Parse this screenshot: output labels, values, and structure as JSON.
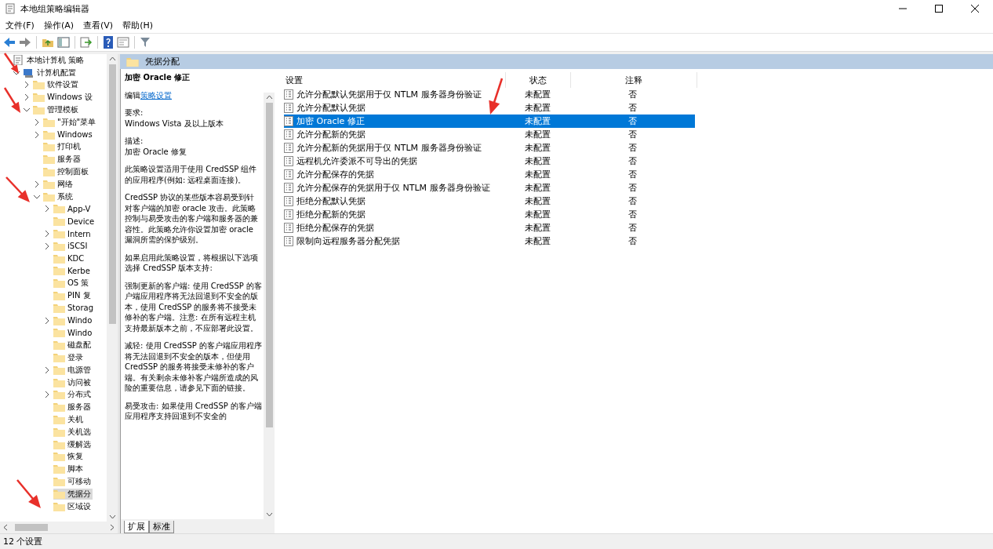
{
  "window": {
    "title": "本地组策略编辑器"
  },
  "menu": [
    "文件(F)",
    "操作(A)",
    "查看(V)",
    "帮助(H)"
  ],
  "tree": [
    {
      "label": "本地计算机 策略",
      "kind": "policy",
      "selected": false,
      "children": [
        {
          "label": "计算机配置",
          "kind": "computer",
          "expanded": true,
          "selected": false,
          "children": [
            {
              "label": "软件设置",
              "kind": "folder",
              "expanded": false,
              "selected": false
            },
            {
              "label": "Windows 设",
              "kind": "folder",
              "expanded": false,
              "selected": false
            },
            {
              "label": "管理模板",
              "kind": "folder",
              "expanded": true,
              "selected": false,
              "children": [
                {
                  "label": "\"开始\"菜单",
                  "kind": "folder",
                  "expanded": false,
                  "selected": false
                },
                {
                  "label": "Windows",
                  "kind": "folder",
                  "expanded": false,
                  "selected": false
                },
                {
                  "label": "打印机",
                  "kind": "folder",
                  "selected": false
                },
                {
                  "label": "服务器",
                  "kind": "folder",
                  "selected": false
                },
                {
                  "label": "控制面板",
                  "kind": "folder",
                  "selected": false
                },
                {
                  "label": "网络",
                  "kind": "folder",
                  "expanded": false,
                  "selected": false
                },
                {
                  "label": "系统",
                  "kind": "folder",
                  "expanded": true,
                  "selected": false,
                  "children": [
                    {
                      "label": "App-V",
                      "kind": "folder",
                      "expanded": false,
                      "selected": false
                    },
                    {
                      "label": "Device",
                      "kind": "folder",
                      "selected": false
                    },
                    {
                      "label": "Intern",
                      "kind": "folder",
                      "expanded": false,
                      "selected": false
                    },
                    {
                      "label": "iSCSI",
                      "kind": "folder",
                      "expanded": false,
                      "selected": false
                    },
                    {
                      "label": "KDC",
                      "kind": "folder",
                      "selected": false
                    },
                    {
                      "label": "Kerbe",
                      "kind": "folder",
                      "selected": false
                    },
                    {
                      "label": "OS 策",
                      "kind": "folder",
                      "selected": false
                    },
                    {
                      "label": "PIN 复",
                      "kind": "folder",
                      "selected": false
                    },
                    {
                      "label": "Storag",
                      "kind": "folder",
                      "selected": false
                    },
                    {
                      "label": "Windo",
                      "kind": "folder",
                      "expanded": false,
                      "selected": false
                    },
                    {
                      "label": "Windo",
                      "kind": "folder",
                      "selected": false
                    },
                    {
                      "label": "磁盘配",
                      "kind": "folder",
                      "selected": false
                    },
                    {
                      "label": "登录",
                      "kind": "folder",
                      "selected": false
                    },
                    {
                      "label": "电源管",
                      "kind": "folder",
                      "expanded": false,
                      "selected": false
                    },
                    {
                      "label": "访问被",
                      "kind": "folder",
                      "selected": false
                    },
                    {
                      "label": "分布式",
                      "kind": "folder",
                      "expanded": false,
                      "selected": false
                    },
                    {
                      "label": "服务器",
                      "kind": "folder",
                      "selected": false
                    },
                    {
                      "label": "关机",
                      "kind": "folder",
                      "selected": false
                    },
                    {
                      "label": "关机选",
                      "kind": "folder",
                      "selected": false
                    },
                    {
                      "label": "缓解选",
                      "kind": "folder",
                      "selected": false
                    },
                    {
                      "label": "恢复",
                      "kind": "folder",
                      "selected": false
                    },
                    {
                      "label": "脚本",
                      "kind": "folder",
                      "selected": false
                    },
                    {
                      "label": "可移动",
                      "kind": "folder",
                      "selected": false
                    },
                    {
                      "label": "凭据分",
                      "kind": "folder",
                      "selected": true
                    },
                    {
                      "label": "区域设",
                      "kind": "folder",
                      "selected": false
                    }
                  ]
                }
              ]
            }
          ]
        }
      ]
    }
  ],
  "header": {
    "title": "凭据分配"
  },
  "description": {
    "title": "加密 Oracle 修正",
    "edit_prefix": "编辑",
    "edit_link": "策略设置",
    "requirements_label": "要求:",
    "requirements": "Windows Vista 及以上版本",
    "description_label": "描述:",
    "description": "加密 Oracle 修复",
    "paragraphs": [
      "此策略设置适用于使用 CredSSP 组件的应用程序(例如: 远程桌面连接)。",
      "CredSSP 协议的某些版本容易受到针对客户端的加密 oracle 攻击。此策略控制与易受攻击的客户端和服务器的兼容性。此策略允许你设置加密 oracle 漏洞所需的保护级别。",
      "如果启用此策略设置，将根据以下选项选择 CredSSP 版本支持:",
      "强制更新的客户端: 使用 CredSSP 的客户端应用程序将无法回退到不安全的版本，使用 CredSSP 的服务将不接受未修补的客户端。注意: 在所有远程主机支持最新版本之前，不应部署此设置。",
      "减轻: 使用 CredSSP 的客户端应用程序将无法回退到不安全的版本，但使用 CredSSP 的服务将接受未修补的客户端。有关剩余未修补客户端所造成的风险的重要信息，请参见下面的链接。",
      "易受攻击: 如果使用 CredSSP 的客户端应用程序支持回退到不安全的"
    ],
    "tabs": [
      {
        "label": "扩展",
        "selected": true
      },
      {
        "label": "标准",
        "selected": false
      }
    ]
  },
  "table": {
    "columns": [
      "设置",
      "状态",
      "注释"
    ],
    "rows": [
      {
        "setting": "允许分配默认凭据用于仅 NTLM 服务器身份验证",
        "state": "未配置",
        "comment": "否",
        "selected": false
      },
      {
        "setting": "允许分配默认凭据",
        "state": "未配置",
        "comment": "否",
        "selected": false
      },
      {
        "setting": "加密 Oracle 修正",
        "state": "未配置",
        "comment": "否",
        "selected": true
      },
      {
        "setting": "允许分配新的凭据",
        "state": "未配置",
        "comment": "否",
        "selected": false
      },
      {
        "setting": "允许分配新的凭据用于仅 NTLM 服务器身份验证",
        "state": "未配置",
        "comment": "否",
        "selected": false
      },
      {
        "setting": "远程机允许委派不可导出的凭据",
        "state": "未配置",
        "comment": "否",
        "selected": false
      },
      {
        "setting": "允许分配保存的凭据",
        "state": "未配置",
        "comment": "否",
        "selected": false
      },
      {
        "setting": "允许分配保存的凭据用于仅 NTLM 服务器身份验证",
        "state": "未配置",
        "comment": "否",
        "selected": false
      },
      {
        "setting": "拒绝分配默认凭据",
        "state": "未配置",
        "comment": "否",
        "selected": false
      },
      {
        "setting": "拒绝分配新的凭据",
        "state": "未配置",
        "comment": "否",
        "selected": false
      },
      {
        "setting": "拒绝分配保存的凭据",
        "state": "未配置",
        "comment": "否",
        "selected": false
      },
      {
        "setting": "限制向远程服务器分配凭据",
        "state": "未配置",
        "comment": "否",
        "selected": false
      }
    ]
  },
  "status_bar": {
    "text": "12 个设置"
  }
}
